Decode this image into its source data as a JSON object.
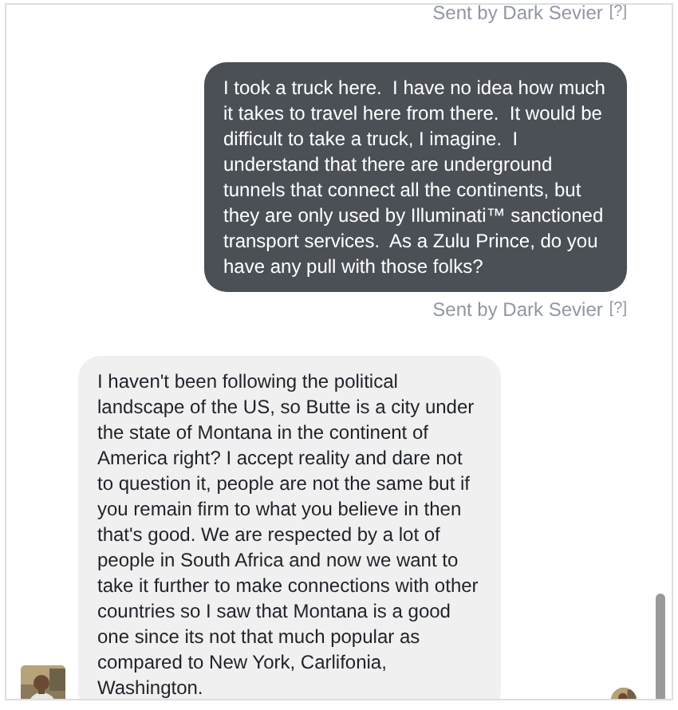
{
  "messages": [
    {
      "kind": "status",
      "text": "Sent by Dark Sevier",
      "help": "[?]"
    },
    {
      "kind": "outgoing",
      "text": "I took a truck here.  I have no idea how much it takes to travel here from there.  It would be difficult to take a truck, I imagine.  I understand that there are underground tunnels that connect all the continents, but they are only used by Illuminati™ sanctioned transport services.  As a Zulu Prince, do you have any pull with those folks?"
    },
    {
      "kind": "status",
      "text": "Sent by Dark Sevier",
      "help": "[?]"
    },
    {
      "kind": "incoming",
      "text": "I haven't been following the political landscape of the US, so Butte is a city under the state of Montana in the continent of America right? I accept reality and dare not to question it, people are not the same but if you remain firm to what you believe in then that's good. We are respected by a lot of people in South Africa and now we want to take it further to make connections with other countries so I saw that Montana is a good one since its not that much popular as compared to New York, Carlifonia, Washington."
    }
  ]
}
